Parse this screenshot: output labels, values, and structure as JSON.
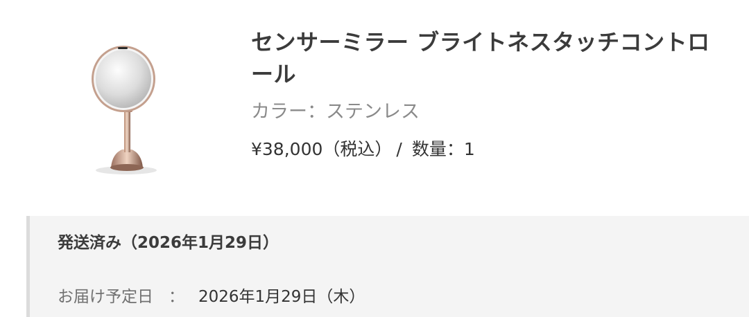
{
  "product": {
    "image_icon": "sensor-mirror-product-image",
    "title": "センサーミラー ブライトネスタッチコントロール",
    "color_text": "カラー：ステンレス",
    "price": "¥38,000（税込）",
    "separator": "/",
    "quantity_text": "数量：1"
  },
  "shipment": {
    "status_text": "発送済み（2026年1月29日）",
    "delivery_label": "お届け予定日",
    "delivery_colon": "：",
    "delivery_date": "2026年1月29日（木）"
  }
}
